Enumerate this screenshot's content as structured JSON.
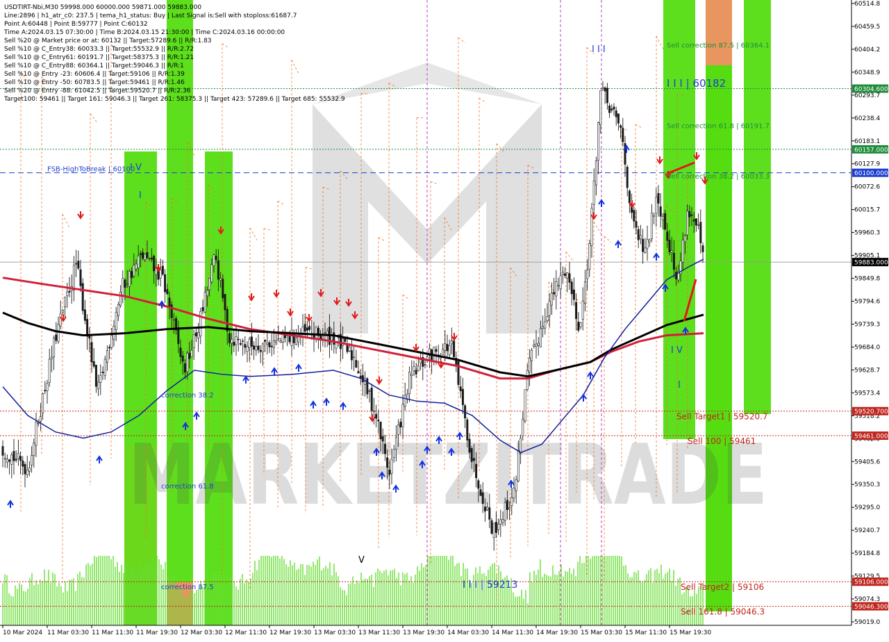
{
  "header": {
    "lines": [
      "USDTIRT-Nbi,M30  59998.000 60000.000 59871.000 59883.000",
      "Line:2896 | h1_atr_c0: 237.5 | tema_h1_status: Buy | Last Signal is:Sell with stoploss:61687.7",
      "Point A:60448 | Point B:59777 | Point C:60132",
      "Time A:2024.03.15 07:30:00 | Time B:2024.03.15 21:30:00 | Time C:2024.03.16 00:00:00",
      "Sell %20 @ Market price or at: 60132 || Target:57289.6 || R/R:1.83",
      "Sell %10 @ C_Entry38: 60033.3 || Target:55532.9 || R/R:2.72",
      "Sell %10 @ C_Entry61: 60191.7 || Target:58375.3 || R/R:1.21",
      "Sell %10 @ C_Entry88: 60364.1 || Target:59046.3 || R/R:1",
      "Sell %10 @ Entry -23: 60606.4 || Target:59106 || R/R:1.39",
      "Sell %10 @ Entry -50: 60783.5 || Target:59461 || R/R:1.46",
      "Sell %20 @ Entry -88: 61042.5 || Target:59520.7 || R/R:2.36",
      "Target100: 59461 || Target 161: 59046.3 || Target 261: 58375.3 || Target 423: 57289.6 || Target 685: 55532.9"
    ]
  },
  "chart_data": {
    "type": "candlestick",
    "symbol": "USDTIRT-Nbi",
    "timeframe": "M30",
    "ohlc_last": {
      "open": 59998.0,
      "high": 60000.0,
      "low": 59871.0,
      "close": 59883.0
    },
    "ylim": [
      59000,
      60520
    ],
    "y_ticks": [
      "60514.8",
      "60459.5",
      "60404.2",
      "60348.9",
      "60293.7",
      "60238.4",
      "60183.1",
      "60127.9",
      "60072.6",
      "60015.7",
      "59960.3",
      "59905.1",
      "59849.8",
      "59794.6",
      "59739.3",
      "59684.0",
      "59628.7",
      "59573.4",
      "59518.2",
      "59462.9",
      "59405.6",
      "59350.3",
      "59295.0",
      "59240.7",
      "59184.8",
      "59129.5",
      "59074.3",
      "59019.0"
    ],
    "x_ticks": [
      "10 Mar 2024",
      "11 Mar 03:30",
      "11 Mar 11:30",
      "11 Mar 19:30",
      "12 Mar 03:30",
      "12 Mar 11:30",
      "12 Mar 19:30",
      "13 Mar 03:30",
      "13 Mar 11:30",
      "13 Mar 19:30",
      "14 Mar 03:30",
      "14 Mar 11:30",
      "14 Mar 19:30",
      "15 Mar 03:30",
      "15 Mar 11:30",
      "15 Mar 19:30"
    ],
    "price_tags": [
      {
        "label": "60304.600",
        "value": 60304.6,
        "color": "#1e8c3a"
      },
      {
        "label": "60157.000",
        "value": 60157.0,
        "color": "#1e8c3a"
      },
      {
        "label": "60100.000",
        "value": 60100.0,
        "color": "#1f3fd0"
      },
      {
        "label": "59883.000",
        "value": 59883.0,
        "color": "#000000"
      },
      {
        "label": "59520.700",
        "value": 59520.7,
        "color": "#c0261e"
      },
      {
        "label": "59461.000",
        "value": 59461.0,
        "color": "#c0261e"
      },
      {
        "label": "59106.000",
        "value": 59106.0,
        "color": "#c0261e"
      },
      {
        "label": "59046.300",
        "value": 59046.3,
        "color": "#c0261e"
      }
    ],
    "levels": [
      {
        "label": "Sell correction 87.5 | 60364.1",
        "value": 60364.1,
        "color": "#1e8c3a"
      },
      {
        "label": "Sell correction 61.8 | 60191.7",
        "value": 60191.7,
        "color": "#1e8c3a"
      },
      {
        "label": "Sell correction 38.2 | 60033.3",
        "value": 60033.3,
        "color": "#1e8c3a"
      },
      {
        "label": "Sell Target1 | 59520.7",
        "value": 59520.7,
        "color": "#c0261e"
      },
      {
        "label": "Sell 100 | 59461",
        "value": 59461.0,
        "color": "#c0261e"
      },
      {
        "label": "Sell Target2 | 59106",
        "value": 59106.0,
        "color": "#c0261e"
      },
      {
        "label": "Sell 161.8 | 59046.3",
        "value": 59046.3,
        "color": "#c0261e"
      },
      {
        "label": "FSB-HighToBreak | 60100",
        "value": 60100.0,
        "color": "#1f3fd0"
      }
    ],
    "annotations": [
      {
        "text": "I I I | 60182",
        "color": "#1f3fd0"
      },
      {
        "text": "I I I | 59213",
        "color": "#1f3fd0"
      },
      {
        "text": "correction 38.2",
        "color": "#1f3fd0"
      },
      {
        "text": "correction 61.8",
        "color": "#1f3fd0"
      },
      {
        "text": "correction 87.5",
        "color": "#1f3fd0"
      },
      {
        "text": "I V",
        "color": "#1f3fd0"
      },
      {
        "text": "I V",
        "color": "#1f3fd0"
      },
      {
        "text": "I",
        "color": "#1f3fd0"
      },
      {
        "text": "I",
        "color": "#1f3fd0"
      },
      {
        "text": "I I I",
        "color": "#1f3fd0"
      },
      {
        "text": "V",
        "color": "#000000"
      }
    ],
    "watermark": "MARKETZITRADE"
  },
  "colors": {
    "background": "#ffffff",
    "green_zone": "#55dd11",
    "orange_zone": "#e8955f",
    "candle": "#1a1a1a",
    "ma_red": "#d0203a",
    "ma_black": "#000000",
    "ma_blue": "#101e9a",
    "orange_dash": "#f07020",
    "volume": "#66dd33"
  }
}
